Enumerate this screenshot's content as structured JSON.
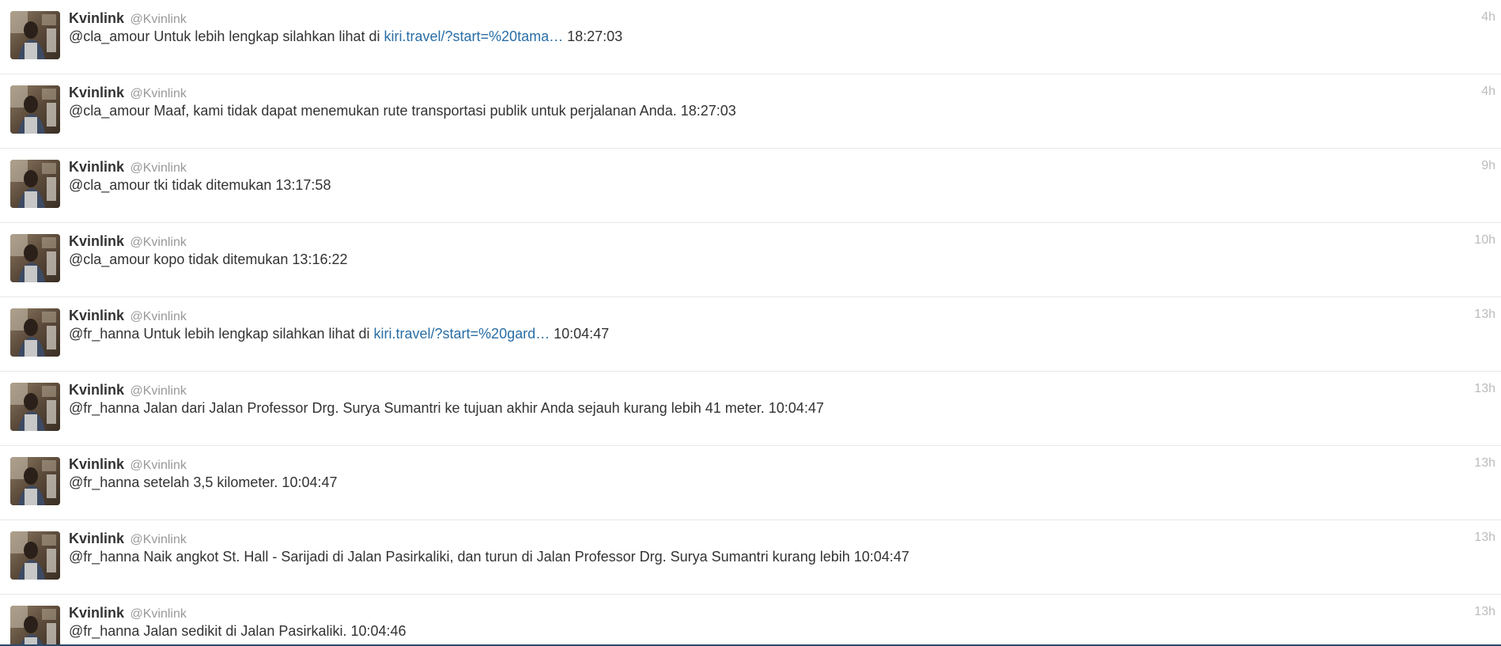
{
  "colors": {
    "link": "#2a6ea6",
    "name": "#333333",
    "handle": "#999999",
    "timestamp": "#bbbbbb",
    "divider": "#e8e8e8",
    "bottom_bar": "#2c4a6b"
  },
  "tweets": [
    {
      "name": "Kvinlink",
      "handle": "@Kvinlink",
      "time": "4h",
      "text_before": "@cla_amour Untuk lebih lengkap silahkan lihat di ",
      "link": "kiri.travel/?start=%20tama…",
      "text_after": " 18:27:03"
    },
    {
      "name": "Kvinlink",
      "handle": "@Kvinlink",
      "time": "4h",
      "text_before": "@cla_amour Maaf, kami tidak dapat menemukan rute transportasi publik untuk perjalanan Anda. 18:27:03",
      "link": "",
      "text_after": ""
    },
    {
      "name": "Kvinlink",
      "handle": "@Kvinlink",
      "time": "9h",
      "text_before": "@cla_amour tki tidak ditemukan 13:17:58",
      "link": "",
      "text_after": ""
    },
    {
      "name": "Kvinlink",
      "handle": "@Kvinlink",
      "time": "10h",
      "text_before": "@cla_amour kopo tidak ditemukan 13:16:22",
      "link": "",
      "text_after": ""
    },
    {
      "name": "Kvinlink",
      "handle": "@Kvinlink",
      "time": "13h",
      "text_before": "@fr_hanna Untuk lebih lengkap silahkan lihat di ",
      "link": "kiri.travel/?start=%20gard…",
      "text_after": " 10:04:47"
    },
    {
      "name": "Kvinlink",
      "handle": "@Kvinlink",
      "time": "13h",
      "text_before": "@fr_hanna Jalan dari Jalan Professor Drg. Surya Sumantri ke tujuan akhir Anda sejauh kurang lebih 41 meter. 10:04:47",
      "link": "",
      "text_after": ""
    },
    {
      "name": "Kvinlink",
      "handle": "@Kvinlink",
      "time": "13h",
      "text_before": "@fr_hanna setelah 3,5 kilometer. 10:04:47",
      "link": "",
      "text_after": ""
    },
    {
      "name": "Kvinlink",
      "handle": "@Kvinlink",
      "time": "13h",
      "text_before": "@fr_hanna Naik angkot St. Hall - Sarijadi di Jalan Pasirkaliki, dan turun di Jalan Professor Drg. Surya Sumantri kurang lebih 10:04:47",
      "link": "",
      "text_after": ""
    },
    {
      "name": "Kvinlink",
      "handle": "@Kvinlink",
      "time": "13h",
      "text_before": "@fr_hanna Jalan sedikit di Jalan Pasirkaliki. 10:04:46",
      "link": "",
      "text_after": ""
    }
  ]
}
